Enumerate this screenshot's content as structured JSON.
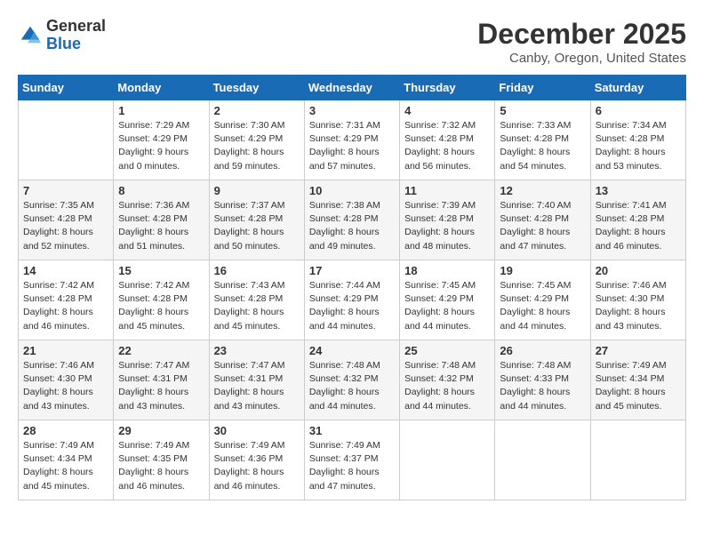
{
  "logo": {
    "general": "General",
    "blue": "Blue"
  },
  "title": "December 2025",
  "location": "Canby, Oregon, United States",
  "weekdays": [
    "Sunday",
    "Monday",
    "Tuesday",
    "Wednesday",
    "Thursday",
    "Friday",
    "Saturday"
  ],
  "weeks": [
    [
      {
        "day": "",
        "sunrise": "",
        "sunset": "",
        "daylight": ""
      },
      {
        "day": "1",
        "sunrise": "Sunrise: 7:29 AM",
        "sunset": "Sunset: 4:29 PM",
        "daylight": "Daylight: 9 hours and 0 minutes."
      },
      {
        "day": "2",
        "sunrise": "Sunrise: 7:30 AM",
        "sunset": "Sunset: 4:29 PM",
        "daylight": "Daylight: 8 hours and 59 minutes."
      },
      {
        "day": "3",
        "sunrise": "Sunrise: 7:31 AM",
        "sunset": "Sunset: 4:29 PM",
        "daylight": "Daylight: 8 hours and 57 minutes."
      },
      {
        "day": "4",
        "sunrise": "Sunrise: 7:32 AM",
        "sunset": "Sunset: 4:28 PM",
        "daylight": "Daylight: 8 hours and 56 minutes."
      },
      {
        "day": "5",
        "sunrise": "Sunrise: 7:33 AM",
        "sunset": "Sunset: 4:28 PM",
        "daylight": "Daylight: 8 hours and 54 minutes."
      },
      {
        "day": "6",
        "sunrise": "Sunrise: 7:34 AM",
        "sunset": "Sunset: 4:28 PM",
        "daylight": "Daylight: 8 hours and 53 minutes."
      }
    ],
    [
      {
        "day": "7",
        "sunrise": "Sunrise: 7:35 AM",
        "sunset": "Sunset: 4:28 PM",
        "daylight": "Daylight: 8 hours and 52 minutes."
      },
      {
        "day": "8",
        "sunrise": "Sunrise: 7:36 AM",
        "sunset": "Sunset: 4:28 PM",
        "daylight": "Daylight: 8 hours and 51 minutes."
      },
      {
        "day": "9",
        "sunrise": "Sunrise: 7:37 AM",
        "sunset": "Sunset: 4:28 PM",
        "daylight": "Daylight: 8 hours and 50 minutes."
      },
      {
        "day": "10",
        "sunrise": "Sunrise: 7:38 AM",
        "sunset": "Sunset: 4:28 PM",
        "daylight": "Daylight: 8 hours and 49 minutes."
      },
      {
        "day": "11",
        "sunrise": "Sunrise: 7:39 AM",
        "sunset": "Sunset: 4:28 PM",
        "daylight": "Daylight: 8 hours and 48 minutes."
      },
      {
        "day": "12",
        "sunrise": "Sunrise: 7:40 AM",
        "sunset": "Sunset: 4:28 PM",
        "daylight": "Daylight: 8 hours and 47 minutes."
      },
      {
        "day": "13",
        "sunrise": "Sunrise: 7:41 AM",
        "sunset": "Sunset: 4:28 PM",
        "daylight": "Daylight: 8 hours and 46 minutes."
      }
    ],
    [
      {
        "day": "14",
        "sunrise": "Sunrise: 7:42 AM",
        "sunset": "Sunset: 4:28 PM",
        "daylight": "Daylight: 8 hours and 46 minutes."
      },
      {
        "day": "15",
        "sunrise": "Sunrise: 7:42 AM",
        "sunset": "Sunset: 4:28 PM",
        "daylight": "Daylight: 8 hours and 45 minutes."
      },
      {
        "day": "16",
        "sunrise": "Sunrise: 7:43 AM",
        "sunset": "Sunset: 4:28 PM",
        "daylight": "Daylight: 8 hours and 45 minutes."
      },
      {
        "day": "17",
        "sunrise": "Sunrise: 7:44 AM",
        "sunset": "Sunset: 4:29 PM",
        "daylight": "Daylight: 8 hours and 44 minutes."
      },
      {
        "day": "18",
        "sunrise": "Sunrise: 7:45 AM",
        "sunset": "Sunset: 4:29 PM",
        "daylight": "Daylight: 8 hours and 44 minutes."
      },
      {
        "day": "19",
        "sunrise": "Sunrise: 7:45 AM",
        "sunset": "Sunset: 4:29 PM",
        "daylight": "Daylight: 8 hours and 44 minutes."
      },
      {
        "day": "20",
        "sunrise": "Sunrise: 7:46 AM",
        "sunset": "Sunset: 4:30 PM",
        "daylight": "Daylight: 8 hours and 43 minutes."
      }
    ],
    [
      {
        "day": "21",
        "sunrise": "Sunrise: 7:46 AM",
        "sunset": "Sunset: 4:30 PM",
        "daylight": "Daylight: 8 hours and 43 minutes."
      },
      {
        "day": "22",
        "sunrise": "Sunrise: 7:47 AM",
        "sunset": "Sunset: 4:31 PM",
        "daylight": "Daylight: 8 hours and 43 minutes."
      },
      {
        "day": "23",
        "sunrise": "Sunrise: 7:47 AM",
        "sunset": "Sunset: 4:31 PM",
        "daylight": "Daylight: 8 hours and 43 minutes."
      },
      {
        "day": "24",
        "sunrise": "Sunrise: 7:48 AM",
        "sunset": "Sunset: 4:32 PM",
        "daylight": "Daylight: 8 hours and 44 minutes."
      },
      {
        "day": "25",
        "sunrise": "Sunrise: 7:48 AM",
        "sunset": "Sunset: 4:32 PM",
        "daylight": "Daylight: 8 hours and 44 minutes."
      },
      {
        "day": "26",
        "sunrise": "Sunrise: 7:48 AM",
        "sunset": "Sunset: 4:33 PM",
        "daylight": "Daylight: 8 hours and 44 minutes."
      },
      {
        "day": "27",
        "sunrise": "Sunrise: 7:49 AM",
        "sunset": "Sunset: 4:34 PM",
        "daylight": "Daylight: 8 hours and 45 minutes."
      }
    ],
    [
      {
        "day": "28",
        "sunrise": "Sunrise: 7:49 AM",
        "sunset": "Sunset: 4:34 PM",
        "daylight": "Daylight: 8 hours and 45 minutes."
      },
      {
        "day": "29",
        "sunrise": "Sunrise: 7:49 AM",
        "sunset": "Sunset: 4:35 PM",
        "daylight": "Daylight: 8 hours and 46 minutes."
      },
      {
        "day": "30",
        "sunrise": "Sunrise: 7:49 AM",
        "sunset": "Sunset: 4:36 PM",
        "daylight": "Daylight: 8 hours and 46 minutes."
      },
      {
        "day": "31",
        "sunrise": "Sunrise: 7:49 AM",
        "sunset": "Sunset: 4:37 PM",
        "daylight": "Daylight: 8 hours and 47 minutes."
      },
      {
        "day": "",
        "sunrise": "",
        "sunset": "",
        "daylight": ""
      },
      {
        "day": "",
        "sunrise": "",
        "sunset": "",
        "daylight": ""
      },
      {
        "day": "",
        "sunrise": "",
        "sunset": "",
        "daylight": ""
      }
    ]
  ]
}
